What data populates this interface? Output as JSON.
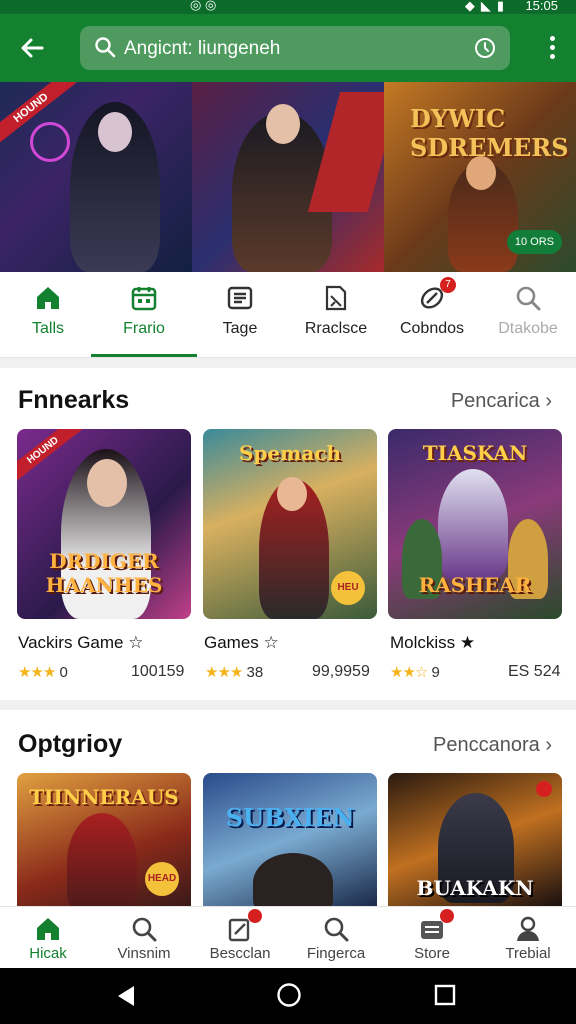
{
  "status_bar": {
    "time": "15:05",
    "notification_icons": "◎ ◎"
  },
  "app_bar": {
    "back_icon": "arrow-left-icon",
    "search_text": "Angicnt: liungeneh",
    "more_icon": "more-vert-icon"
  },
  "banner": {
    "ribbon": "HOUND",
    "title": "DYWIC SDREMERS",
    "badge": "10 ORS"
  },
  "tabs": [
    {
      "label": "Talls",
      "icon": "home-icon"
    },
    {
      "label": "Frario",
      "icon": "calendar-icon"
    },
    {
      "label": "Tage",
      "icon": "list-icon"
    },
    {
      "label": "Rraclsce",
      "icon": "document-icon"
    },
    {
      "label": "Cobndos",
      "icon": "link-icon",
      "badge": "7"
    },
    {
      "label": "Dtakobe",
      "icon": "search-icon"
    }
  ],
  "section1": {
    "title": "Fnnearks",
    "link": "Pencarica",
    "cards": [
      {
        "image_text": "DRDIGER HAANHES",
        "ribbon": "HOUND",
        "name": "Vackirs Game",
        "rating": "0",
        "count": "100159"
      },
      {
        "image_text_top": "Spemach",
        "badge": "HEU",
        "name": "Games",
        "rating": "38",
        "count": "99,9959"
      },
      {
        "image_text_top": "TIASKAN",
        "image_text": "RASHEAR",
        "name": "Molckiss",
        "rating": "9",
        "count": "ES 524"
      }
    ]
  },
  "section2": {
    "title": "Optgrioy",
    "link": "Penccanora",
    "cards": [
      {
        "image_text_top": "TIINNERAUS",
        "badge": "HEAD"
      },
      {
        "image_text_top": "SUBXIEN"
      },
      {
        "image_text": "BUAKAKN"
      }
    ]
  },
  "bottom_nav": [
    {
      "label": "Hicak",
      "icon": "home-icon"
    },
    {
      "label": "Vinsnim",
      "icon": "search-icon"
    },
    {
      "label": "Bescclan",
      "icon": "edit-icon"
    },
    {
      "label": "Fingerca",
      "icon": "search-icon"
    },
    {
      "label": "Store",
      "icon": "store-icon"
    },
    {
      "label": "Trebial",
      "icon": "person-icon"
    }
  ],
  "colors": {
    "brand": "#13812f",
    "star": "#f3b51b",
    "badge_red": "#d62020"
  }
}
